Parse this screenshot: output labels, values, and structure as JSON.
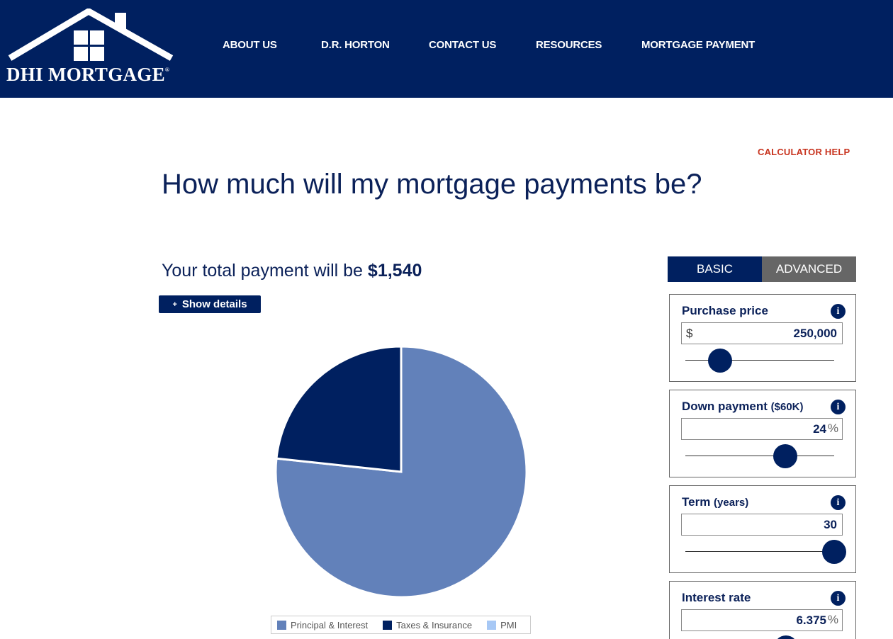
{
  "brand": {
    "logo_text": "DHI MORTGAGE",
    "logo_mark": "®",
    "header_color": "#002060"
  },
  "nav": [
    {
      "label": "ABOUT US"
    },
    {
      "label": "D.R. HORTON"
    },
    {
      "label": "CONTACT US"
    },
    {
      "label": "RESOURCES"
    },
    {
      "label": "MORTGAGE PAYMENT"
    }
  ],
  "help": {
    "label": "CALCULATOR HELP",
    "color": "#c8341f"
  },
  "page": {
    "title": "How much will my mortgage payments be?"
  },
  "summary": {
    "prefix": "Your total payment will be",
    "amount": "$1,540",
    "show_details_icon": "+",
    "show_details_label": "Show details"
  },
  "chart_data": {
    "type": "pie",
    "slices": [
      {
        "label": "Principal & Interest",
        "value": 76.7,
        "color": "#6281ba"
      },
      {
        "label": "Taxes & Insurance",
        "value": 23.3,
        "color": "#002060"
      },
      {
        "label": "PMI",
        "value": 0,
        "color": "#a7c8f5"
      }
    ],
    "legend_position": "bottom"
  },
  "tabs": [
    {
      "label": "BASIC",
      "active": true
    },
    {
      "label": "ADVANCED",
      "active": false
    }
  ],
  "inputs": {
    "purchase_price": {
      "label": "Purchase price",
      "prefix": "$",
      "value": "250,000",
      "info_icon": "info-icon",
      "slider_level": 0.16
    },
    "down_payment": {
      "label": "Down payment",
      "sub": "($60K)",
      "value": "24",
      "suffix": "%",
      "info_icon": "info-icon",
      "slider_level": 0.64
    },
    "term": {
      "label": "Term",
      "sub": "(years)",
      "value": "30",
      "info_icon": "info-icon",
      "slider_level": 1.0
    },
    "interest_rate": {
      "label": "Interest rate",
      "value": "6.375",
      "suffix": "%",
      "info_icon": "info-icon"
    }
  }
}
